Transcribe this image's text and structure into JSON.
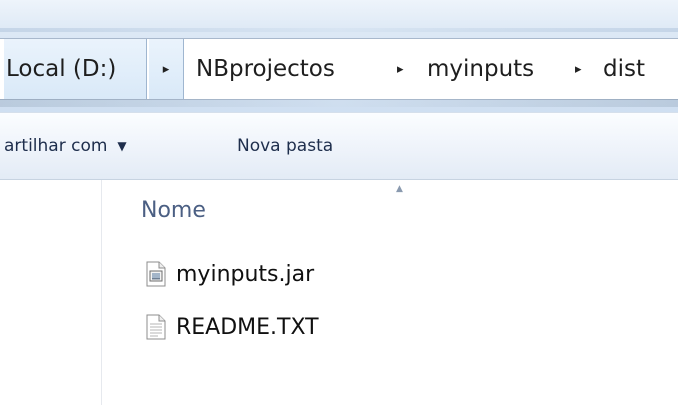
{
  "address_bar": {
    "crumbs": [
      "Local (D:)",
      "NBprojectos",
      "myinputs",
      "dist"
    ],
    "separator": "▸"
  },
  "toolbar": {
    "share_label": "artilhar com",
    "share_caret": "▼",
    "new_folder_label": "Nova pasta"
  },
  "file_list": {
    "column_name": "Nome",
    "sort_arrow": "▲",
    "files": [
      {
        "name": "myinputs.jar",
        "icon": "jar-file-icon"
      },
      {
        "name": "README.TXT",
        "icon": "text-file-icon"
      }
    ]
  }
}
